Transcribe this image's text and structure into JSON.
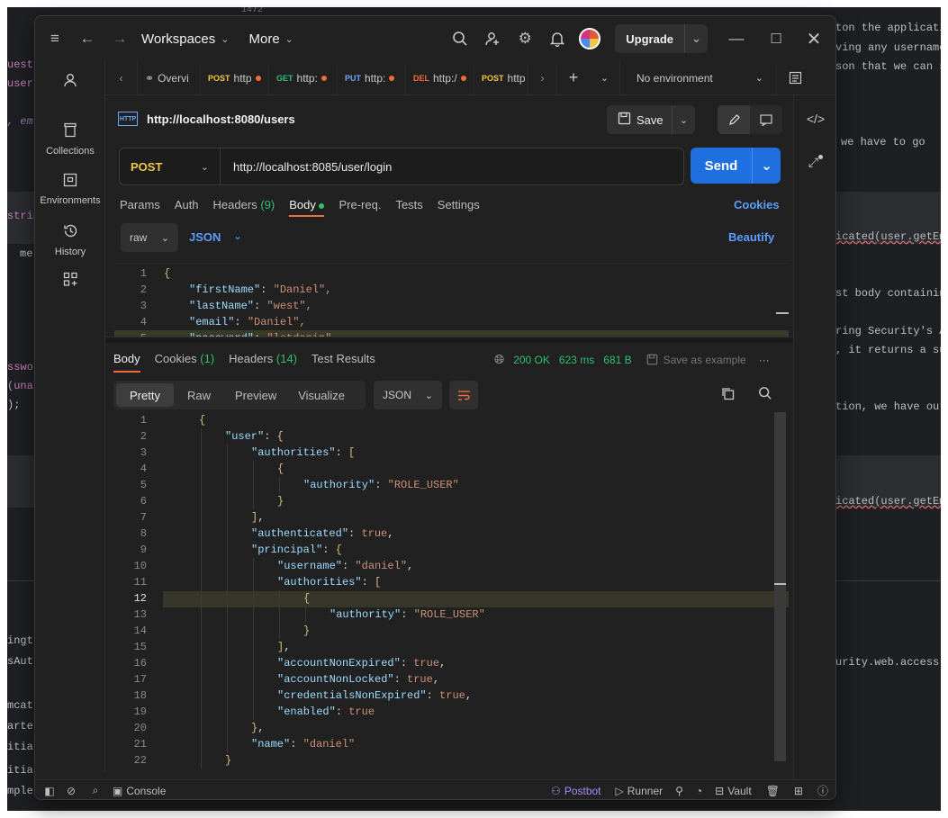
{
  "bg": {
    "top_num": "1472",
    "left": [
      "uest",
      "user",
      ", em",
      "strin",
      "me",
      "sswo",
      "(una",
      ");",
      "ingt",
      "sAut",
      "mcat",
      "arte",
      "itia",
      "itia",
      "mple"
    ],
    "right": [
      "ton the applicati",
      "ving any username",
      "son that we can s",
      "we have to go",
      "icated(user.getEm",
      "st body containin",
      "ring Security's A",
      ", it returns a su",
      "tion, we have our",
      "icated(user.getEm",
      "urity.web.access"
    ]
  },
  "titlebar": {
    "workspaces": "Workspaces",
    "more": "More",
    "upgrade": "Upgrade"
  },
  "sidebar": {
    "items": [
      {
        "label": "",
        "icon": "user-icon"
      },
      {
        "label": "Collections",
        "icon": "trash-icon"
      },
      {
        "label": "Environments",
        "icon": "environment-icon"
      },
      {
        "label": "History",
        "icon": "history-icon"
      },
      {
        "label": "",
        "icon": "grid-plus-icon"
      }
    ]
  },
  "tabs": [
    {
      "method": "",
      "label": "Overvi"
    },
    {
      "method": "POST",
      "label": "http",
      "color": "#f4c542"
    },
    {
      "method": "GET",
      "label": "http:",
      "color": "#2fbf71"
    },
    {
      "method": "PUT",
      "label": "http:",
      "color": "#6aa9ff"
    },
    {
      "method": "DEL",
      "label": "http:/",
      "color": "#f26b3a"
    },
    {
      "method": "POST",
      "label": "http",
      "color": "#f4c542"
    }
  ],
  "environment": "No environment",
  "request": {
    "badge": "HTTP",
    "title": "http://localhost:8080/users",
    "save": "Save",
    "method": "POST",
    "url": "http://localhost:8085/user/login",
    "send": "Send",
    "tabs": [
      "Params",
      "Auth",
      "Headers",
      "Body",
      "Pre-req.",
      "Tests",
      "Settings"
    ],
    "headers_count": "(9)",
    "cookies": "Cookies",
    "body_mode": "raw",
    "body_type": "JSON",
    "beautify": "Beautify",
    "lines": [
      {
        "n": "1",
        "t": "{"
      },
      {
        "n": "2",
        "k": "\"firstName\"",
        "v": "\"Daniel\","
      },
      {
        "n": "3",
        "k": "\"lastName\"",
        "v": "\"west\","
      },
      {
        "n": "4",
        "k": "\"email\"",
        "v": "\"Daniel\","
      },
      {
        "n": "5",
        "k": "\"password\"",
        "v": "\"letdanin\""
      }
    ]
  },
  "response": {
    "tabs": [
      "Body",
      "Cookies",
      "Headers",
      "Test Results"
    ],
    "cookies_count": "(1)",
    "headers_count": "(14)",
    "status": "200 OK",
    "time": "623 ms",
    "size": "681 B",
    "save_example": "Save as example",
    "views": [
      "Pretty",
      "Raw",
      "Preview",
      "Visualize"
    ],
    "format": "JSON",
    "lines": [
      {
        "n": "1",
        "i": 0,
        "p": [
          [
            "b",
            "{"
          ]
        ]
      },
      {
        "n": "2",
        "i": 1,
        "p": [
          [
            "k",
            "\"user\""
          ],
          [
            "d",
            ": "
          ],
          [
            "b",
            "{"
          ]
        ]
      },
      {
        "n": "3",
        "i": 2,
        "p": [
          [
            "k",
            "\"authorities\""
          ],
          [
            "d",
            ": "
          ],
          [
            "b",
            "["
          ]
        ]
      },
      {
        "n": "4",
        "i": 3,
        "p": [
          [
            "b",
            "{"
          ]
        ]
      },
      {
        "n": "5",
        "i": 4,
        "p": [
          [
            "k",
            "\"authority\""
          ],
          [
            "d",
            ": "
          ],
          [
            "s",
            "\"ROLE_USER\""
          ]
        ]
      },
      {
        "n": "6",
        "i": 3,
        "p": [
          [
            "b",
            "}"
          ]
        ]
      },
      {
        "n": "7",
        "i": 2,
        "p": [
          [
            "b",
            "]"
          ],
          [
            "d",
            ","
          ]
        ]
      },
      {
        "n": "8",
        "i": 2,
        "p": [
          [
            "k",
            "\"authenticated\""
          ],
          [
            "d",
            ": "
          ],
          [
            "s",
            "true"
          ],
          [
            "d",
            ","
          ]
        ]
      },
      {
        "n": "9",
        "i": 2,
        "p": [
          [
            "k",
            "\"principal\""
          ],
          [
            "d",
            ": "
          ],
          [
            "b",
            "{"
          ]
        ]
      },
      {
        "n": "10",
        "i": 3,
        "p": [
          [
            "k",
            "\"username\""
          ],
          [
            "d",
            ": "
          ],
          [
            "s",
            "\"daniel\""
          ],
          [
            "d",
            ","
          ]
        ]
      },
      {
        "n": "11",
        "i": 3,
        "p": [
          [
            "k",
            "\"authorities\""
          ],
          [
            "d",
            ": "
          ],
          [
            "b",
            "["
          ]
        ]
      },
      {
        "n": "12",
        "i": 4,
        "p": [
          [
            "b",
            "{"
          ]
        ]
      },
      {
        "n": "13",
        "i": 5,
        "p": [
          [
            "k",
            "\"authority\""
          ],
          [
            "d",
            ": "
          ],
          [
            "s",
            "\"ROLE_USER\""
          ]
        ]
      },
      {
        "n": "14",
        "i": 4,
        "p": [
          [
            "b",
            "}"
          ]
        ]
      },
      {
        "n": "15",
        "i": 3,
        "p": [
          [
            "b",
            "]"
          ],
          [
            "d",
            ","
          ]
        ]
      },
      {
        "n": "16",
        "i": 3,
        "p": [
          [
            "k",
            "\"accountNonExpired\""
          ],
          [
            "d",
            ": "
          ],
          [
            "s",
            "true"
          ],
          [
            "d",
            ","
          ]
        ]
      },
      {
        "n": "17",
        "i": 3,
        "p": [
          [
            "k",
            "\"accountNonLocked\""
          ],
          [
            "d",
            ": "
          ],
          [
            "s",
            "true"
          ],
          [
            "d",
            ","
          ]
        ]
      },
      {
        "n": "18",
        "i": 3,
        "p": [
          [
            "k",
            "\"credentialsNonExpired\""
          ],
          [
            "d",
            ": "
          ],
          [
            "s",
            "true"
          ],
          [
            "d",
            ","
          ]
        ]
      },
      {
        "n": "19",
        "i": 3,
        "p": [
          [
            "k",
            "\"enabled\""
          ],
          [
            "d",
            ": "
          ],
          [
            "s",
            "true"
          ]
        ]
      },
      {
        "n": "20",
        "i": 2,
        "p": [
          [
            "b",
            "}"
          ],
          [
            "d",
            ","
          ]
        ]
      },
      {
        "n": "21",
        "i": 2,
        "p": [
          [
            "k",
            "\"name\""
          ],
          [
            "d",
            ": "
          ],
          [
            "s",
            "\"daniel\""
          ]
        ]
      },
      {
        "n": "22",
        "i": 1,
        "p": [
          [
            "b",
            "}"
          ]
        ]
      }
    ]
  },
  "statusbar": {
    "console": "Console",
    "postbot": "Postbot",
    "runner": "Runner",
    "vault": "Vault"
  },
  "colors": {
    "accent": "#1f6fe0",
    "post": "#f4c542",
    "ok": "#2fbf71",
    "link": "#5c9dff"
  }
}
